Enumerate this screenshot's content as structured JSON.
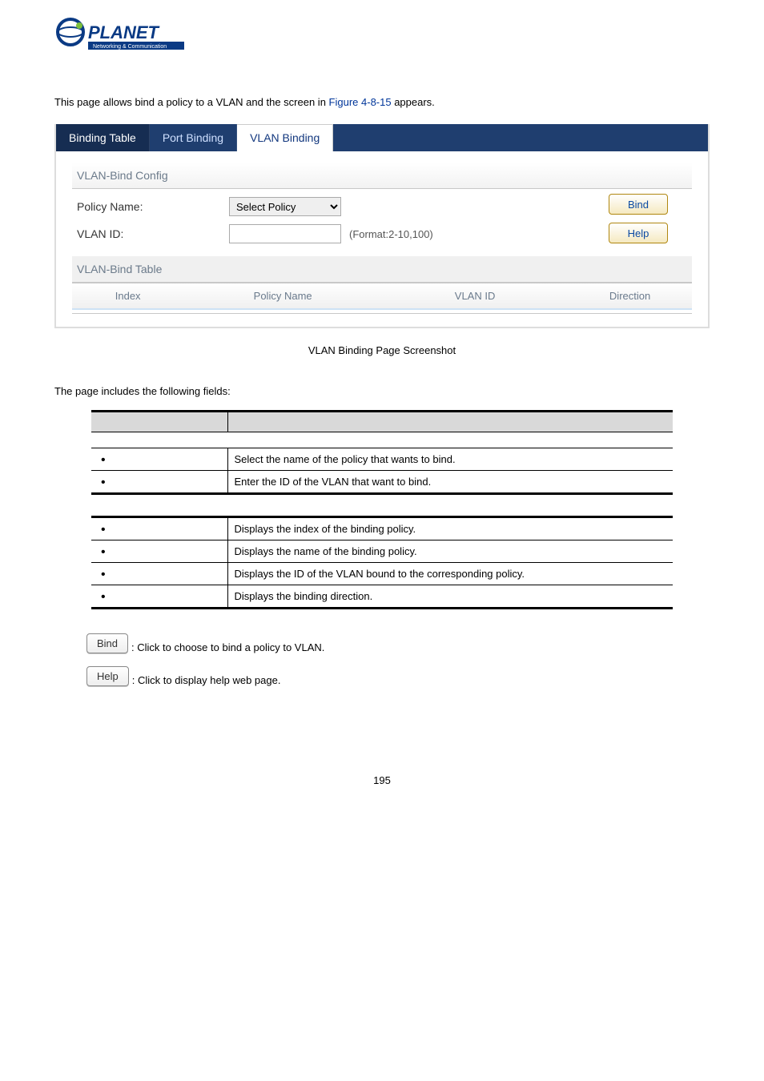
{
  "logo": {
    "brand": "PLANET",
    "tagline": "Networking & Communication"
  },
  "intro": {
    "prefix": "This page allows bind a policy to a VLAN and the screen in ",
    "figref": "Figure 4-8-15",
    "suffix": " appears."
  },
  "ui": {
    "tabs": {
      "binding_table": "Binding Table",
      "port_binding": "Port Binding",
      "vlan_binding": "VLAN Binding"
    },
    "vlan_bind_config": {
      "title": "VLAN-Bind Config",
      "policy_name_label": "Policy Name:",
      "policy_name_option": "Select Policy",
      "vlan_id_label": "VLAN ID:",
      "vlan_id_hint": "(Format:2-10,100)"
    },
    "buttons": {
      "bind": "Bind",
      "help": "Help"
    },
    "vlan_bind_table": {
      "title": "VLAN-Bind Table",
      "cols": {
        "index": "Index",
        "policy_name": "Policy Name",
        "vlan_id": "VLAN ID",
        "direction": "Direction"
      }
    }
  },
  "caption": "VLAN Binding Page Screenshot",
  "fields_intro": "The page includes the following fields:",
  "desc1": {
    "rows": [
      {
        "desc": "Select the name of the policy that wants to bind."
      },
      {
        "desc": "Enter the ID of the VLAN that want to bind."
      }
    ]
  },
  "desc2": {
    "rows": [
      {
        "desc": "Displays the index of the binding policy."
      },
      {
        "desc": "Displays the name of the binding policy."
      },
      {
        "desc": "Displays the ID of the VLAN bound to the corresponding policy."
      },
      {
        "desc": "Displays the binding direction."
      }
    ]
  },
  "btn_desc": {
    "bind": {
      "label": "Bind",
      "text": ": Click to choose to bind a policy to VLAN."
    },
    "help": {
      "label": "Help",
      "text": ": Click to display help web page."
    }
  },
  "page_num": "195"
}
